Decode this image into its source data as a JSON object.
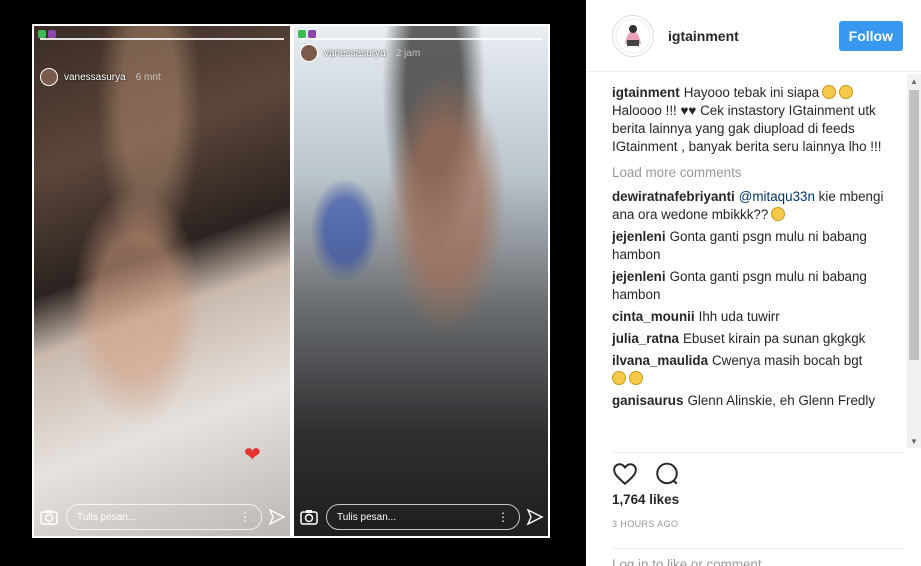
{
  "photo": {
    "left_story": {
      "username": "vanessasurya",
      "time": "6 mnt",
      "reply_placeholder": "Tulis pesan..."
    },
    "right_story": {
      "username": "vanessasurya",
      "time": "2 jam",
      "reply_placeholder": "Tulis pesan..."
    }
  },
  "header": {
    "username": "igtainment",
    "follow_label": "Follow"
  },
  "caption": {
    "username": "igtainment",
    "text": "Hayooo tebak ini siapa",
    "text2": "Haloooo !!! ♥♥ Cek instastory IGtainment utk berita lainnya yang gak diupload di feeds IGtainment , banyak berita seru lainnya lho !!!"
  },
  "load_more": "Load more comments",
  "comments": [
    {
      "user": "dewiratnafebriyanti",
      "mention": "@mitaqu33n",
      "text": "kie mbengi ana ora wedone mbikkk??"
    },
    {
      "user": "jejenleni",
      "text": "Gonta ganti psgn mulu ni babang hambon"
    },
    {
      "user": "jejenleni",
      "text": "Gonta ganti psgn mulu ni babang hambon"
    },
    {
      "user": "cinta_mounii",
      "text": "Ihh uda tuwirr"
    },
    {
      "user": "julia_ratna",
      "text": "Ebuset kirain pa sunan gkgkgk"
    },
    {
      "user": "ilvana_maulida",
      "text": "Cwenya masih bocah bgt"
    },
    {
      "user": "ganisaurus",
      "text": "Glenn Alinskie, eh Glenn Fredly"
    }
  ],
  "likes": "1,764 likes",
  "time_ago": "3 HOURS AGO",
  "add_comment": {
    "login_text": "Log in",
    "rest_text": " to like or comment."
  },
  "colors": {
    "follow_button": "#3897f0",
    "heart_sticker": "#e3342f"
  },
  "icons": {
    "like": "heart-icon",
    "comment": "comment-icon",
    "camera": "camera-icon",
    "send": "send-icon"
  }
}
